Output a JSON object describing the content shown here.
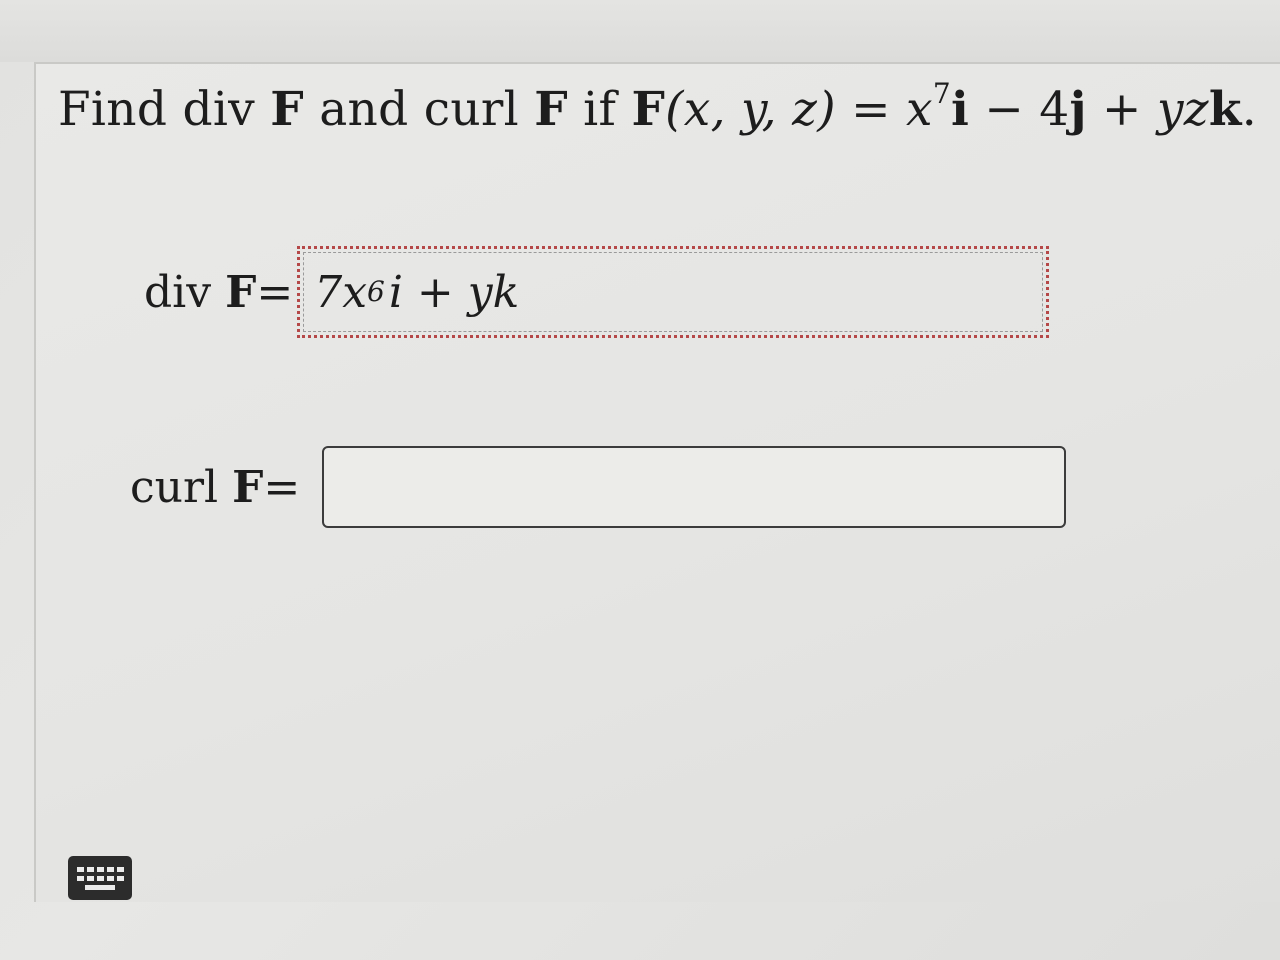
{
  "question": {
    "text_find": "Find div",
    "bold_F1": "F",
    "text_and_curl": "and curl",
    "bold_F2": "F",
    "text_if": "if",
    "bold_F3": "F",
    "args": "(x, y, z)",
    "equals": " = ",
    "term_x": "x",
    "exponent_7": "7",
    "bold_i": "i",
    "minus_4": " − 4",
    "bold_j": "j",
    "plus_yz": " + yz",
    "bold_k": "k",
    "period": "."
  },
  "div_row": {
    "label_text": "div",
    "label_bold": "F",
    "label_equals": "=",
    "answer_value": "7x",
    "answer_exponent": "6",
    "answer_rest": "i + yk"
  },
  "curl_row": {
    "label_text": "curl",
    "label_bold": "F",
    "label_equals": "=",
    "answer_value": ""
  },
  "keyboard": {
    "icon": "keyboard-icon"
  }
}
